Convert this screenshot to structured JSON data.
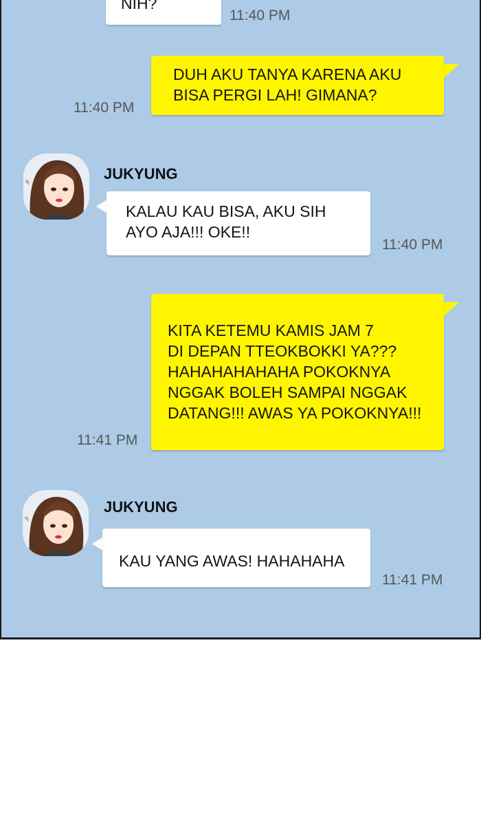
{
  "colors": {
    "chat_background": "#adcbe6",
    "outgoing_bubble": "#fff500",
    "incoming_bubble": "#ffffff",
    "timestamp_text": "#55565a"
  },
  "messages": [
    {
      "sender": "",
      "direction": "incoming",
      "text": "NIH?",
      "time": "11:40 PM"
    },
    {
      "sender": "",
      "direction": "outgoing",
      "text": "DUH AKU TANYA KARENA AKU\nBISA PERGI LAH! GIMANA?",
      "time": "11:40 PM"
    },
    {
      "sender": "JUKYUNG",
      "direction": "incoming",
      "text": "KALAU KAU BISA, AKU SIH\nAYO AJA!!! OKE!!",
      "time": "11:40 PM"
    },
    {
      "sender": "",
      "direction": "outgoing",
      "text": "KITA KETEMU KAMIS JAM 7\nDI DEPAN TTEOKBOKKI YA???\nHAHAHAHAHAHA POKOKNYA\nNGGAK BOLEH SAMPAI NGGAK\nDATANG!!! AWAS YA POKOKNYA!!!",
      "time": "11:41 PM"
    },
    {
      "sender": "JUKYUNG",
      "direction": "incoming",
      "text": "KAU YANG AWAS! HAHAHAHA",
      "time": "11:41 PM"
    }
  ]
}
